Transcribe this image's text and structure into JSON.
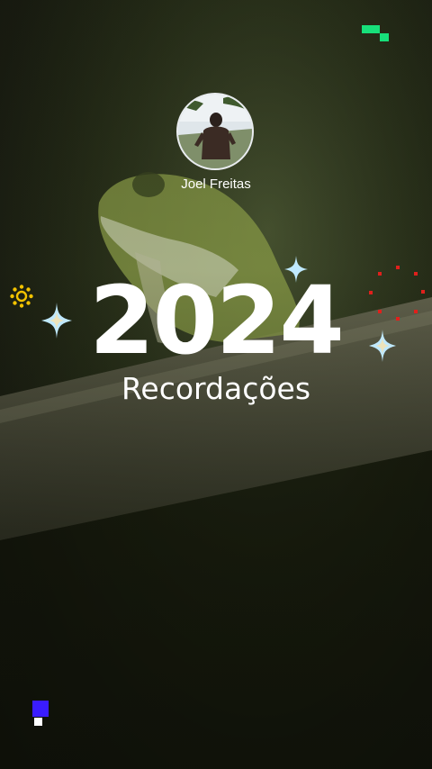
{
  "story": {
    "user_name": "Joel Freitas",
    "year": "2024",
    "subtitle": "Recordações"
  },
  "colors": {
    "accent_green": "#17e07a",
    "accent_blue": "#3a1cff",
    "accent_yellow": "#f2c200",
    "accent_red": "#e0201c",
    "sparkle": "#bfe9ff"
  },
  "icons": [
    "pixel-logo-icon",
    "sun-icon",
    "sparkle-icon",
    "dotted-burst-icon",
    "pixel-square-icon"
  ]
}
